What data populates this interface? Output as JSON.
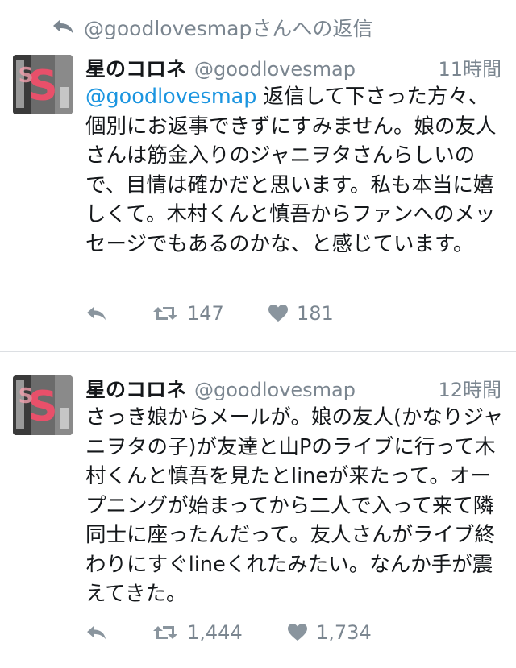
{
  "reply_header": {
    "icon": "reply-icon",
    "text": "@goodlovesmapさんへの返信"
  },
  "tweets": [
    {
      "name": "星のコロネ",
      "handle": "@goodlovesmap",
      "time": "11時間",
      "mention": "@goodlovesmap",
      "text": " 返信して下さった方々、個別にお返事できずにすみません。娘の友人さんは筋金入りのジャニヲタさんらしいので、目情は確かだと思います。私も本当に嬉しくて。木村くんと慎吾からファンへのメッセージでもあるのかな、と感じています。",
      "retweets": "147",
      "likes": "181"
    },
    {
      "name": "星のコロネ",
      "handle": "@goodlovesmap",
      "time": "12時間",
      "mention": "",
      "text": "さっき娘からメールが。娘の友人(かなりジャニヲタの子)が友達と山Pのライブに行って木村くんと慎吾を見たとlineが来たって。オープニングが始まってから二人で入って来て隣同士に座ったんだって。友人さんがライブ終わりにすぐlineくれたみたい。なんか手が震えてきた。",
      "retweets": "1,444",
      "likes": "1,734"
    }
  ],
  "icons": {
    "reply": "reply-icon",
    "retweet": "retweet-icon",
    "like": "heart-icon",
    "avatar": "avatar-image"
  },
  "colors": {
    "mention": "#1b95e0",
    "secondary_text": "#7b8690",
    "icon": "#8a959e",
    "avatar_accent": "#e8506a"
  }
}
